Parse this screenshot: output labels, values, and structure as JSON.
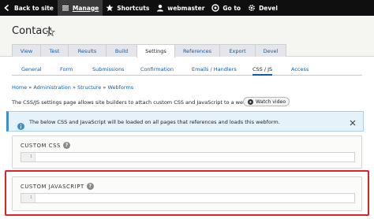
{
  "toolbar": {
    "items": [
      {
        "label": "Back to site",
        "icon": "back-arrow-icon"
      },
      {
        "label": "Manage",
        "icon": "hamburger-menu-icon"
      },
      {
        "label": "Shortcuts",
        "icon": "star-icon"
      },
      {
        "label": "webmaster",
        "icon": "user-icon"
      },
      {
        "label": "Go to",
        "icon": "go-to-icon"
      },
      {
        "label": "Devel",
        "icon": "gear-icon"
      }
    ]
  },
  "header": {
    "title": "Contact",
    "tabs": [
      "View",
      "Test",
      "Results",
      "Build",
      "Settings",
      "References",
      "Export",
      "Devel"
    ],
    "active_tab": "Settings"
  },
  "subtabs": {
    "items": [
      "General",
      "Form",
      "Submissions",
      "Confirmation",
      "Emails / Handlers",
      "CSS / JS",
      "Access"
    ],
    "active": "CSS / JS"
  },
  "breadcrumb": [
    "Home",
    "Administration",
    "Structure",
    "Webforms"
  ],
  "breadcrumb_sep": "»",
  "description": "The CSS/JS settings page allows site builders to attach custom CSS and JavaScript to a webform.",
  "watch_video": "Watch video",
  "message": "The below CSS and JavaScript will be loaded on all pages that references and loads this webform.",
  "sections": {
    "css": {
      "title": "CUSTOM CSS",
      "line": "1"
    },
    "js": {
      "title": "CUSTOM JAVASCRIPT",
      "line": "1"
    }
  },
  "help_glyph": "?",
  "colors": {
    "toolbar": "#0f0f0f",
    "link": "#0b5da9",
    "highlight": "#e0202a",
    "message_bg": "#e6f2f9"
  }
}
